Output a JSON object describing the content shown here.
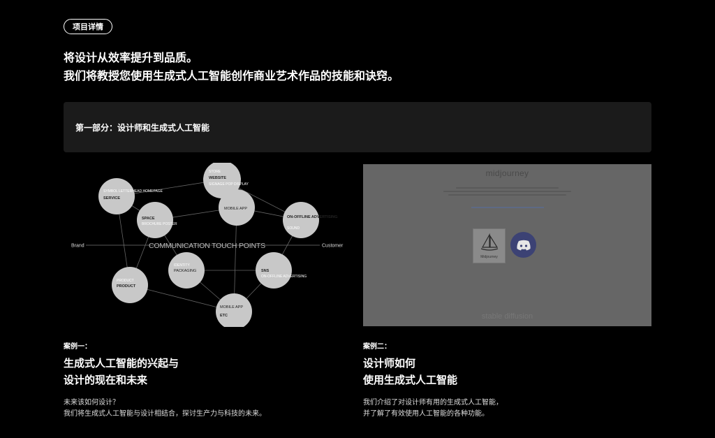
{
  "header": {
    "pill_label": "项目详情",
    "headline_line1": "将设计从效率提升到品质。",
    "headline_line2": "我们将教授您使用生成式人工智能创作商业艺术作品的技能和诀窍。"
  },
  "section": {
    "title": "第一部分：设计师和生成式人工智能"
  },
  "diagram": {
    "left_label": "Brand",
    "right_label": "Customer",
    "center_label": "COMMUNICATION TOUCH POINTS",
    "nodes": [
      {
        "title": "WEBSITE",
        "sub": "SIGNAGE POP DISPLAY",
        "extra": "STORE"
      },
      {
        "title": "SERVICE",
        "sub": "SYMBOL LETTERHEAD HOMEPAGE"
      },
      {
        "title": "MOBILE APP"
      },
      {
        "title": "SPACE",
        "sub": "BROCHURE POSTER"
      },
      {
        "title": "ON-OFFLINE ADVERTISING",
        "sub": "SOUND"
      },
      {
        "title": "PACKAGING",
        "sub": "IDENTITY"
      },
      {
        "title": "SNS",
        "sub": "ON-OFFLINE ADVERTISING"
      },
      {
        "title": "PRODUCT",
        "sub": "PRODUCT"
      },
      {
        "title": "MOBILE APP",
        "sub": "ETC"
      }
    ]
  },
  "screenshot": {
    "logo_text": "midjourney",
    "card_label": "Midjourney",
    "footer_text": "stable diffusion",
    "icon": "discord-icon"
  },
  "cases": [
    {
      "tag": "案例一：",
      "title_line1": "生成式人工智能的兴起与",
      "title_line2": "设计的现在和未来",
      "desc_line1": "未来该如何设计？",
      "desc_line2": "我们将生成式人工智能与设计相结合，探讨生产力与科技的未来。"
    },
    {
      "tag": "案例二：",
      "title_line1": "设计师如何",
      "title_line2": "使用生成式人工智能",
      "desc_line1": "我们介绍了对设计师有用的生成式人工智能，",
      "desc_line2": "并了解了有效使用人工智能的各种功能。"
    }
  ]
}
